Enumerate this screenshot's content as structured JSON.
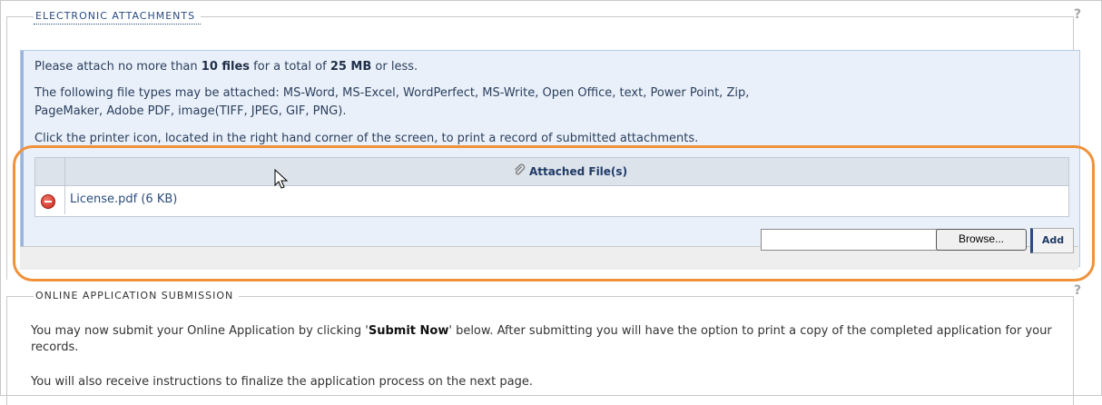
{
  "section1": {
    "legend": "Electronic Attachments",
    "info": {
      "line1_prefix": "Please attach no more than ",
      "line1_bold1": "10 files",
      "line1_mid": " for a total of ",
      "line1_bold2": "25 MB",
      "line1_suffix": " or less.",
      "line2a": "The following file types may be attached: MS-Word, MS-Excel, WordPerfect, MS-Write, Open Office, text, Power Point, Zip,",
      "line2b": "PageMaker, Adobe PDF, image(TIFF, JPEG, GIF, PNG).",
      "line3": "Click the printer icon, located in the right hand corner of the screen, to print a record of submitted attachments."
    },
    "table": {
      "header": "Attached File(s)",
      "rows": [
        {
          "file": "License.pdf  (6 KB)"
        }
      ]
    },
    "upload": {
      "value": "",
      "browse_label": "Browse...",
      "add_label": "Add"
    },
    "help": "?"
  },
  "section2": {
    "legend": "Online Application Submission",
    "help": "?",
    "para1_prefix": "You may now submit your Online Application by clicking '",
    "para1_bold": "Submit Now",
    "para1_suffix": "' below. After submitting you will have the option to print a copy of the completed application for your records.",
    "para2": "You will also receive instructions to finalize the application process on the next page."
  },
  "colors": {
    "accent": "#2a4b80",
    "highlight": "#f0923a",
    "info_bg": "#e9f0fa"
  }
}
